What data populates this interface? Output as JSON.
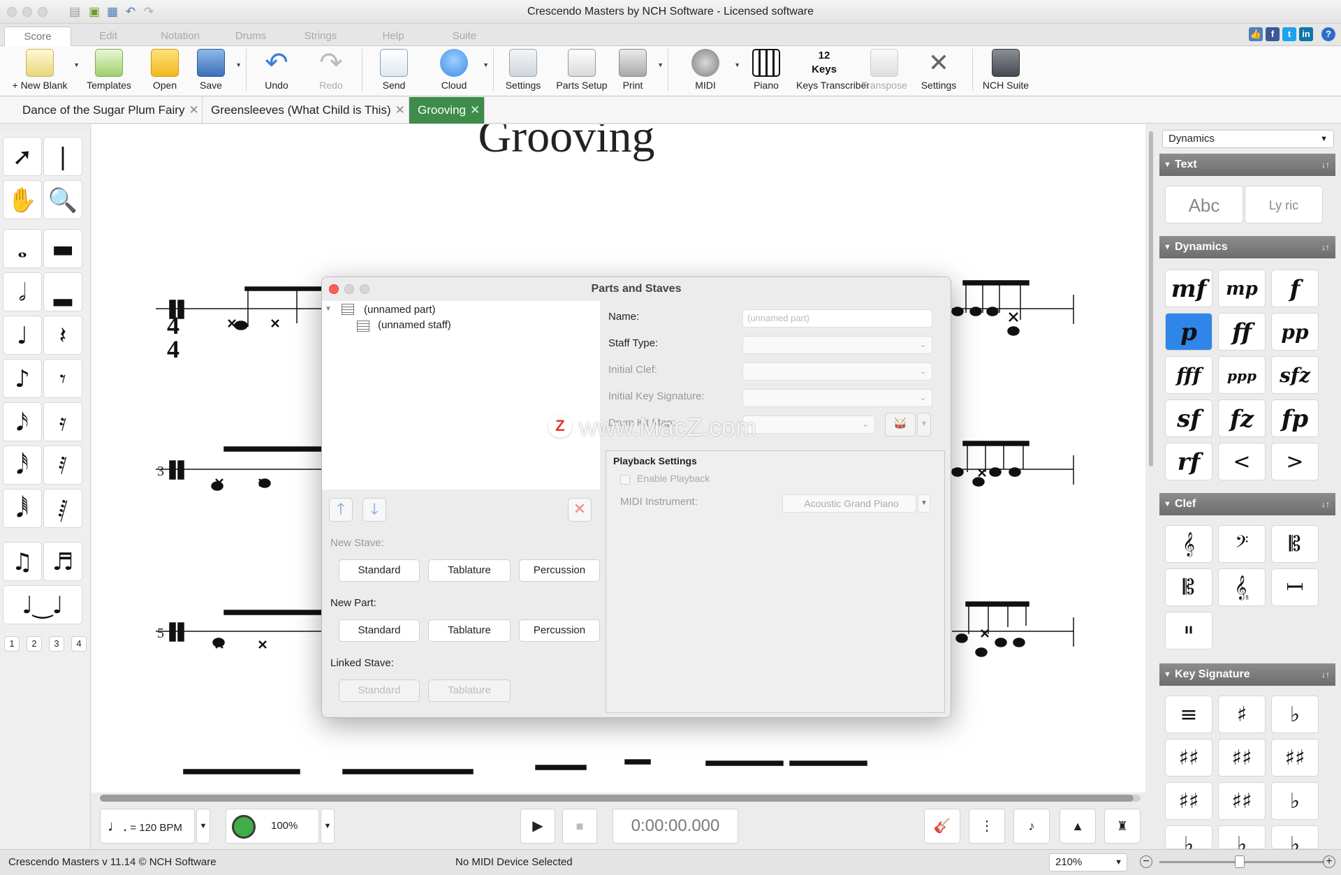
{
  "window": {
    "title": "Crescendo Masters by NCH Software - Licensed software"
  },
  "menu_tabs": [
    "Score",
    "Edit",
    "Notation",
    "Drums",
    "Strings",
    "Help",
    "Suite"
  ],
  "toolbar": {
    "new_blank": "+ New Blank",
    "templates": "Templates",
    "open": "Open",
    "save": "Save",
    "undo": "Undo",
    "redo": "Redo",
    "send": "Send",
    "cloud": "Cloud",
    "settings": "Settings",
    "parts_setup": "Parts Setup",
    "print": "Print",
    "midi": "MIDI",
    "piano": "Piano",
    "keys_transcriber": "Keys Transcriber",
    "keys_icon_text": "12 Keys",
    "transpose": "Transpose",
    "settings2": "Settings",
    "nch_suite": "NCH Suite"
  },
  "doc_tabs": [
    "Dance of the Sugar Plum Fairy",
    "Greensleeves (What Child is This)",
    "Grooving"
  ],
  "score": {
    "title": "Grooving",
    "measure_numbers": [
      "3",
      "5"
    ]
  },
  "palette": {
    "pages": [
      "1",
      "2",
      "3",
      "4"
    ]
  },
  "right_panel": {
    "dropdown": "Dynamics",
    "text_section": "Text",
    "text_buttons": [
      "Abc",
      "Ly ric"
    ],
    "dynamics_section": "Dynamics",
    "dynamics": [
      "mf",
      "mp",
      "f",
      "p",
      "ff",
      "pp",
      "fff",
      "ppp",
      "sfz",
      "sf",
      "fz",
      "fp",
      "rf",
      "<",
      ">"
    ],
    "clef_section": "Clef",
    "key_section": "Key Signature"
  },
  "dialog": {
    "title": "Parts and Staves",
    "tree_part": "(unnamed part)",
    "tree_staff": "(unnamed staff)",
    "name_label": "Name:",
    "name_placeholder": "(unnamed part)",
    "staff_type_label": "Staff Type:",
    "initial_clef_label": "Initial Clef:",
    "initial_key_label": "Initial Key Signature:",
    "drum_kit_label": "Drum Kit Map:",
    "playback_title": "Playback Settings",
    "enable_playback": "Enable Playback",
    "midi_instrument_label": "MIDI Instrument:",
    "midi_instrument_value": "Acoustic Grand Piano",
    "new_stave_label": "New Stave:",
    "new_part_label": "New Part:",
    "linked_stave_label": "Linked Stave:",
    "standard": "Standard",
    "tablature": "Tablature",
    "percussion": "Percussion",
    "watermark": "www.MacZ.com",
    "watermark_logo": "Z"
  },
  "transport": {
    "tempo": "= 120 BPM",
    "volume": "100%",
    "time": "0:00:00.000"
  },
  "status": {
    "version": "Crescendo Masters v 11.14 © NCH Software",
    "midi": "No MIDI Device Selected",
    "zoom": "210%"
  },
  "colors": {
    "accent_green": "#3f8c4a",
    "selected_blue": "#2f86e8",
    "header_gray": "#7a7a7a"
  }
}
